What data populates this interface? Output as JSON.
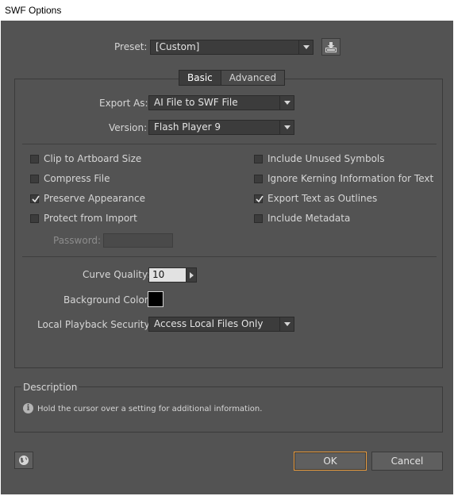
{
  "window": {
    "title": "SWF Options"
  },
  "preset": {
    "label": "Preset:",
    "value": "[Custom]"
  },
  "tabs": [
    {
      "label": "Basic",
      "active": true
    },
    {
      "label": "Advanced",
      "active": false
    }
  ],
  "export_as": {
    "label": "Export As:",
    "value": "AI File to SWF File"
  },
  "version": {
    "label": "Version:",
    "value": "Flash Player 9"
  },
  "options_left": [
    {
      "label": "Clip to Artboard Size",
      "checked": false
    },
    {
      "label": "Compress File",
      "checked": false
    },
    {
      "label": "Preserve Appearance",
      "checked": true
    },
    {
      "label": "Protect from Import",
      "checked": false
    }
  ],
  "options_right": [
    {
      "label": "Include Unused Symbols",
      "checked": false
    },
    {
      "label": "Ignore Kerning Information for Text",
      "checked": false
    },
    {
      "label": "Export Text as Outlines",
      "checked": true
    },
    {
      "label": "Include Metadata",
      "checked": false
    }
  ],
  "password": {
    "label": "Password:",
    "value": ""
  },
  "curve_quality": {
    "label": "Curve Quality:",
    "value": "10"
  },
  "background_color": {
    "label": "Background Color:",
    "value": "#000000"
  },
  "local_playback": {
    "label": "Local Playback Security:",
    "value": "Access Local Files Only"
  },
  "description": {
    "title": "Description",
    "text": "Hold the cursor over a setting for additional information."
  },
  "buttons": {
    "ok": "OK",
    "cancel": "Cancel"
  },
  "colors": {
    "panel": "#535353",
    "field": "#3c3c3c",
    "ok_border": "#e89a3c"
  },
  "icons": {
    "save_preset": "save-preset-icon",
    "globe": "globe-icon",
    "info": "info-icon"
  }
}
